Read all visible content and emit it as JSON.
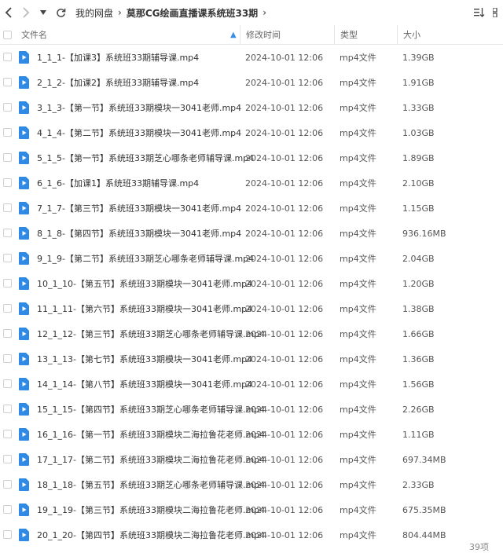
{
  "toolbar": {
    "breadcrumbs": [
      "我的网盘",
      "莫那CG绘画直播课系统班33期"
    ]
  },
  "columns": {
    "name": "文件名",
    "time": "修改时间",
    "type": "类型",
    "size": "大小"
  },
  "files": [
    {
      "name": "1_1_1-【加课3】系统班33期辅导课.mp4",
      "time": "2024-10-01 12:06",
      "type": "mp4文件",
      "size": "1.39GB"
    },
    {
      "name": "2_1_2-【加课2】系统班33期辅导课.mp4",
      "time": "2024-10-01 12:06",
      "type": "mp4文件",
      "size": "1.91GB"
    },
    {
      "name": "3_1_3-【第一节】系统班33期模块一3041老师.mp4",
      "time": "2024-10-01 12:06",
      "type": "mp4文件",
      "size": "1.33GB"
    },
    {
      "name": "4_1_4-【第二节】系统班33期模块一3041老师.mp4",
      "time": "2024-10-01 12:06",
      "type": "mp4文件",
      "size": "1.03GB"
    },
    {
      "name": "5_1_5-【第一节】系统班33期芝心哪条老师辅导课.mp4",
      "time": "2024-10-01 12:06",
      "type": "mp4文件",
      "size": "1.89GB"
    },
    {
      "name": "6_1_6-【加课1】系统班33期辅导课.mp4",
      "time": "2024-10-01 12:06",
      "type": "mp4文件",
      "size": "2.10GB"
    },
    {
      "name": "7_1_7-【第三节】系统班33期模块一3041老师.mp4",
      "time": "2024-10-01 12:06",
      "type": "mp4文件",
      "size": "1.15GB"
    },
    {
      "name": "8_1_8-【第四节】系统班33期模块一3041老师.mp4",
      "time": "2024-10-01 12:06",
      "type": "mp4文件",
      "size": "936.16MB"
    },
    {
      "name": "9_1_9-【第二节】系统班33期芝心哪条老师辅导课.mp4",
      "time": "2024-10-01 12:06",
      "type": "mp4文件",
      "size": "2.04GB"
    },
    {
      "name": "10_1_10-【第五节】系统班33期模块一3041老师.mp4",
      "time": "2024-10-01 12:06",
      "type": "mp4文件",
      "size": "1.20GB"
    },
    {
      "name": "11_1_11-【第六节】系统班33期模块一3041老师.mp4",
      "time": "2024-10-01 12:06",
      "type": "mp4文件",
      "size": "1.38GB"
    },
    {
      "name": "12_1_12-【第三节】系统班33期芝心哪条老师辅导课.mp4",
      "time": "2024-10-01 12:06",
      "type": "mp4文件",
      "size": "1.66GB"
    },
    {
      "name": "13_1_13-【第七节】系统班33期模块一3041老师.mp4",
      "time": "2024-10-01 12:06",
      "type": "mp4文件",
      "size": "1.36GB"
    },
    {
      "name": "14_1_14-【第八节】系统班33期模块一3041老师.mp4",
      "time": "2024-10-01 12:06",
      "type": "mp4文件",
      "size": "1.56GB"
    },
    {
      "name": "15_1_15-【第四节】系统班33期芝心哪条老师辅导课.mp4",
      "time": "2024-10-01 12:06",
      "type": "mp4文件",
      "size": "2.26GB"
    },
    {
      "name": "16_1_16-【第一节】系统班33期模块二海拉鲁花老师.mp4",
      "time": "2024-10-01 12:06",
      "type": "mp4文件",
      "size": "1.11GB"
    },
    {
      "name": "17_1_17-【第二节】系统班33期模块二海拉鲁花老师.mp4",
      "time": "2024-10-01 12:06",
      "type": "mp4文件",
      "size": "697.34MB"
    },
    {
      "name": "18_1_18-【第五节】系统班33期芝心哪条老师辅导课.mp4",
      "time": "2024-10-01 12:06",
      "type": "mp4文件",
      "size": "2.33GB"
    },
    {
      "name": "19_1_19-【第三节】系统班33期模块二海拉鲁花老师.mp4",
      "time": "2024-10-01 12:06",
      "type": "mp4文件",
      "size": "675.35MB"
    },
    {
      "name": "20_1_20-【第四节】系统班33期模块二海拉鲁花老师.mp4",
      "time": "2024-10-01 12:06",
      "type": "mp4文件",
      "size": "804.44MB"
    }
  ],
  "footer": {
    "count": "39项"
  },
  "colors": {
    "file_icon": "#2f8ae5",
    "sort_arrow": "#3a90e6"
  }
}
